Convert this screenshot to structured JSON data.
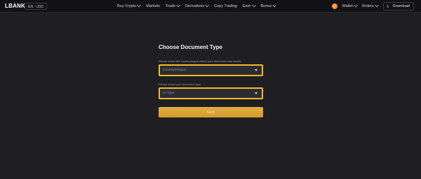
{
  "topbar": {
    "logo": "LBANK",
    "locale": "EN · USD",
    "nav": [
      {
        "label": "Buy Crypto",
        "dropdown": true
      },
      {
        "label": "Markets",
        "dropdown": false
      },
      {
        "label": "Trade",
        "dropdown": true
      },
      {
        "label": "Derivatives",
        "dropdown": true
      },
      {
        "label": "Copy Trading",
        "dropdown": false
      },
      {
        "label": "Earn",
        "dropdown": true
      },
      {
        "label": "Bonus",
        "dropdown": true
      }
    ],
    "wallet": "Wallet",
    "orders": "Orders",
    "download": "Download"
  },
  "form": {
    "title": "Choose Document Type",
    "country_label": "Please select the country/region where your document was issued.",
    "country_placeholder": "Country/Region",
    "doc_label": "Please select your document type.",
    "doc_placeholder": "ID Type",
    "next": "Next"
  },
  "colors": {
    "accent": "#f3ba2f",
    "background": "#1f1f23",
    "topbar": "#121214"
  }
}
